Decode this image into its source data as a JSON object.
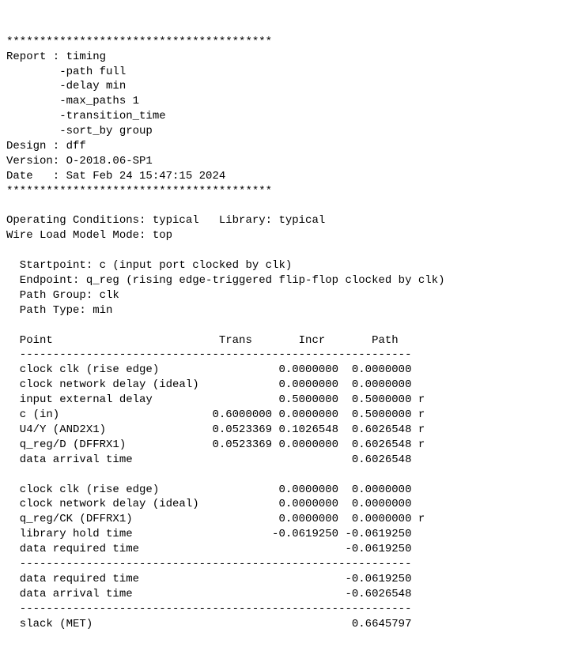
{
  "stars": "****************************************",
  "header": {
    "report_label": "Report : timing",
    "opt1": "        -path full",
    "opt2": "        -delay min",
    "opt3": "        -max_paths 1",
    "opt4": "        -transition_time",
    "opt5": "        -sort_by group",
    "design": "Design : dff",
    "version": "Version: O-2018.06-SP1",
    "date": "Date   : Sat Feb 24 15:47:15 2024"
  },
  "cond": {
    "line1": "Operating Conditions: typical   Library: typical",
    "line2": "Wire Load Model Mode: top"
  },
  "path": {
    "start": "  Startpoint: c (input port clocked by clk)",
    "end": "  Endpoint: q_reg (rising edge-triggered flip-flop clocked by clk)",
    "group": "  Path Group: clk",
    "type": "  Path Type: min"
  },
  "table": {
    "header": "  Point                         Trans       Incr       Path",
    "dash": "  -----------------------------------------------------------",
    "r1": "  clock clk (rise edge)                  0.0000000  0.0000000",
    "r2": "  clock network delay (ideal)            0.0000000  0.0000000",
    "r3": "  input external delay                   0.5000000  0.5000000 r",
    "r4": "  c (in)                       0.6000000 0.0000000  0.5000000 r",
    "r5": "  U4/Y (AND2X1)                0.0523369 0.1026548  0.6026548 r",
    "r6": "  q_reg/D (DFFRX1)             0.0523369 0.0000000  0.6026548 r",
    "r7": "  data arrival time                                 0.6026548",
    "r8": "  clock clk (rise edge)                  0.0000000  0.0000000",
    "r9": "  clock network delay (ideal)            0.0000000  0.0000000",
    "r10": "  q_reg/CK (DFFRX1)                      0.0000000  0.0000000 r",
    "r11": "  library hold time                     -0.0619250 -0.0619250",
    "r12": "  data required time                               -0.0619250",
    "r13": "  data required time                               -0.0619250",
    "r14": "  data arrival time                                -0.6026548",
    "r15": "  slack (MET)                                       0.6645797"
  }
}
